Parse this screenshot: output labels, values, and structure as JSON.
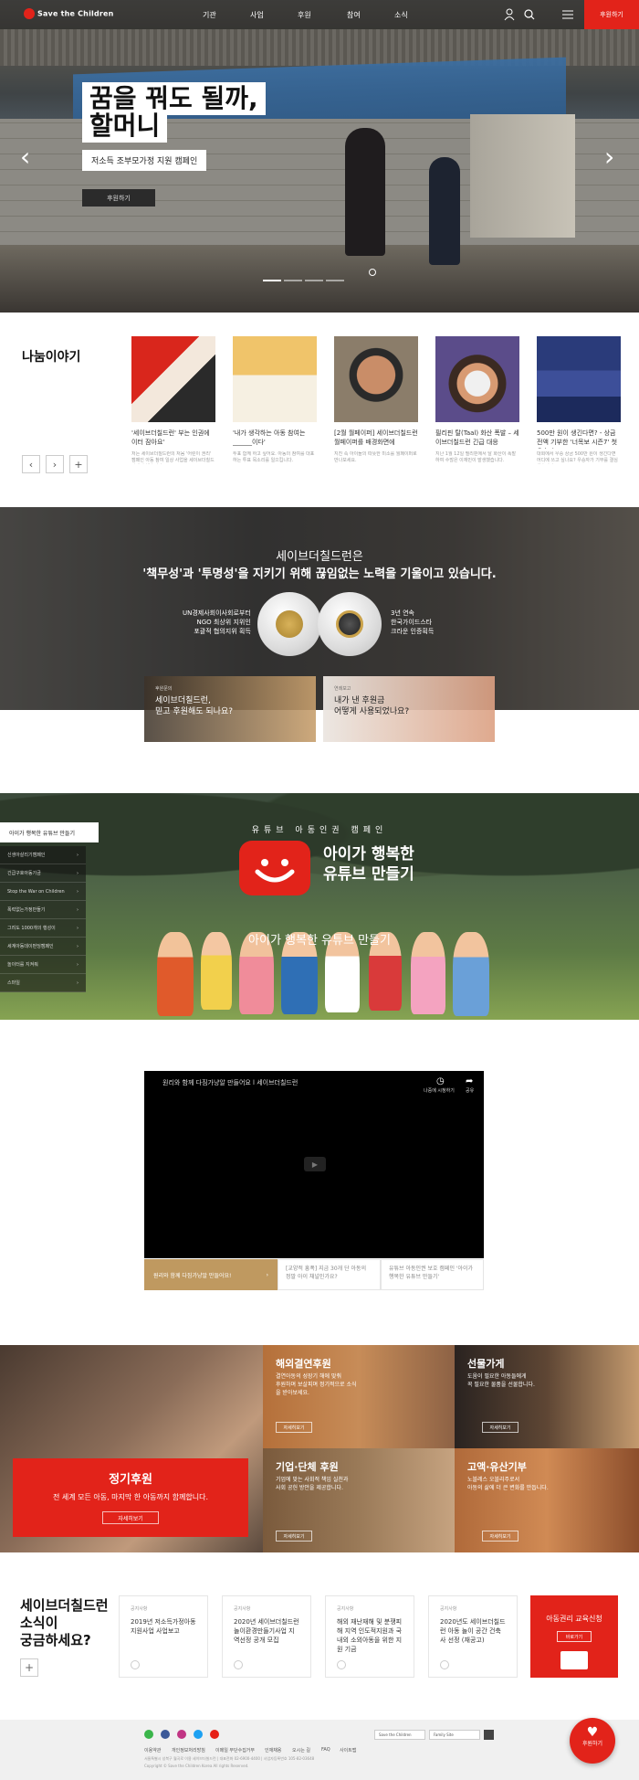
{
  "header": {
    "logo_text": "Save the Children",
    "nav": [
      "기관",
      "사업",
      "후원",
      "참여",
      "소식"
    ],
    "donate_label": "후원하기",
    "brand_color": "#e2231a"
  },
  "hero": {
    "title_line1": "꿈을 꿔도 될까,",
    "title_line2": "할머니",
    "subtitle": "저소득 조부모가정 지원 캠페인",
    "button": "후원하기",
    "prev_icon": "chevron-left-icon",
    "next_icon": "chevron-right-icon"
  },
  "stories": {
    "title": "나눔이야기",
    "cards": [
      {
        "caption": "'세이브더칠드런' 부는 인권에이터 잠아요'",
        "desc": "저는 세이브더칠드런의 처음 '어린이 권리' 캠페인 아동 참여 일상 사업을 세이브더칠드런에서 했습니다."
      },
      {
        "caption": "'내가 생각하는 아동 참여는 ______이다'",
        "desc": "투표 함께 하고 싶어요. 아동의 참여를 대표하는 투표 목소리를 일으킵니다."
      },
      {
        "caption": "[2월 월페이퍼] 세이브더칠드런 월페이퍼를 배경화면에",
        "desc": "지진 속 아이들의 따뜻한 미소를 월페이퍼로 만나보세요."
      },
      {
        "caption": "필리핀 탈(Taal) 화산 폭발 – 세이브더칠드런 긴급 대응",
        "desc": "지난 1월 12일 필리핀에서 탈 화산이 폭발하여 수많은 이재민이 발생했습니다."
      },
      {
        "caption": "500만 원이 생긴다면? - 상금 전액 기부한 '너목보 시즌7' 첫 우승자",
        "desc": "대회에서 우승 상금 500만 원이 생긴다면 어디에 쓰고 싶나요? 우승자가 기부를 결심했습니다."
      }
    ]
  },
  "trust": {
    "headline1": "세이브더칠드런은",
    "headline2": "'책무성'과 '투명성'을 지키기 위해 끊임없는 노력을 기울이고 있습니다.",
    "left_text": [
      "UN경제사회이사회로부터",
      "NGO 최상위 지위인",
      "포괄적 협의지위 획득"
    ],
    "right_text": [
      "3년 연속",
      "한국가이드스타",
      "크라운 인증획득"
    ],
    "card1_kicker": "후원문의",
    "card1_title": [
      "세이브더칠드런,",
      "믿고 후원해도 되나요?"
    ],
    "card2_kicker": "연례보고",
    "card2_title": [
      "내가 낸 후원금",
      "어떻게 사용되었나요?"
    ]
  },
  "campaign": {
    "active_label": "아이가 행복한 유튜브 만들기",
    "menu": [
      "신생아살리기캠페인",
      "긴급구호아동기금",
      "Stop the War on Children",
      "폭력없는가정만들기",
      "그려도 1000개의 행성이",
      "세계아동데이펀딩캠페인",
      "놀이터를 지켜줘",
      "스마일"
    ],
    "kicker": "유튜브 아동인권 캠페인",
    "title_line1": "아이가 행복한",
    "title_line2": "유튜브 만들기",
    "subtitle": "아이가 행복한 유튜브 만들기"
  },
  "video": {
    "title": "원리와 함께 다짐가냥알 만들어요 l 세이브더칠드런",
    "watch_later": "나중에 시청하기",
    "share": "공유",
    "tabs": [
      "원리와 함께 다짐가냥알 만들어요!",
      "[교양적 흥폭] 지금 30개 단 아동의 정말 아이 채널인가요?",
      "유튜브 아동인권 보호 캠페인 '아이가 행복한 유튜브 만들기'"
    ]
  },
  "donate_grid": {
    "regular_title": "정기후원",
    "regular_desc": "전 세계 모든 아동, 마지막 한 아동까지 함께합니다.",
    "tiles": [
      {
        "title": "해외결연후원",
        "desc": [
          "결연아동의 성장기 해에 맞춰",
          "후원하며 보살피며 정기적으로 소식을 받아보세요."
        ]
      },
      {
        "title": "선물가게",
        "desc": [
          "도움이 필요한 아동들에게",
          "꼭 필요한 물품을 선물합니다."
        ]
      },
      {
        "title": "기업·단체 후원",
        "desc": [
          "기업에 맞는 사회적 책임 실천과",
          "사회 공헌 방안을 제공합니다."
        ]
      },
      {
        "title": "고액·유산기부",
        "desc": [
          "노블레스 오블리주로서",
          "아동의 삶에 더 큰 변화를 만듭니다."
        ]
      }
    ],
    "more_label": "자세히보기"
  },
  "news": {
    "title": [
      "세이브더칠드런",
      "소식이",
      "궁금하세요?"
    ],
    "cards": [
      {
        "kicker": "공지사항",
        "title": "2019년 저소득가정아동지원사업 사업보고"
      },
      {
        "kicker": "공지사항",
        "title": "2020년 세이브더칠드런 놀이환경만들기사업 지역선정 공개 모집"
      },
      {
        "kicker": "공지사항",
        "title": "해외 재난재해 및 분쟁피해 지역 인도적지원과 국내외 소외아동을 위한 지원 기금"
      },
      {
        "kicker": "공지사항",
        "title": "2020년도 세이브더칠드런 아동 놀이 공간 건축사 선정 (재공고)"
      }
    ],
    "edu_title": "아동권리 교육신청",
    "edu_button": "바로가기"
  },
  "footer": {
    "links": [
      "이용약관",
      "개인정보처리방침",
      "이메일 무단수집거부",
      "인재채용",
      "오시는 길",
      "FAQ",
      "사이트맵"
    ],
    "select1": "Save the Children",
    "select2": "Family Site",
    "info": "서울특별시 성북구 월곡로 이용 세이브더칠드런 | 대표전화 02-6900-4400 | 사업자등록번호 105-82-03648",
    "copyright": "Copyright © Save the Children Korea All rights Reserved.",
    "float_donate": "후원하기"
  }
}
